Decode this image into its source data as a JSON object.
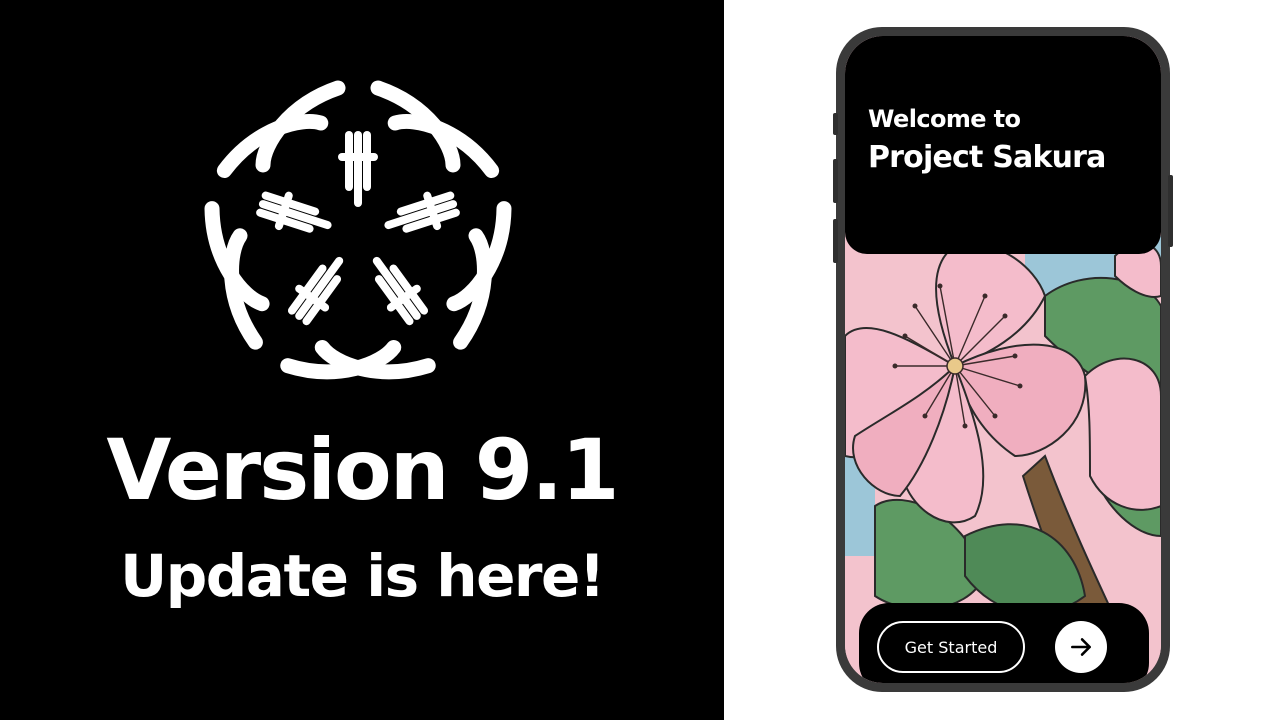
{
  "promo": {
    "logo_icon": "cherry-blossom-icon",
    "headline": "Version 9.1",
    "subheadline": "Update is here!"
  },
  "phone": {
    "welcome_text": "Welcome to",
    "app_name": "Project Sakura",
    "artwork": "cherry-blossom-illustration",
    "get_started_label": "Get Started",
    "next_icon": "arrow-right-icon"
  },
  "colors": {
    "left_background": "#000000",
    "right_background": "#ffffff",
    "petal_pink": "#f4bccb",
    "leaf_green": "#5e9a63",
    "branch_brown": "#7a5a3a"
  }
}
